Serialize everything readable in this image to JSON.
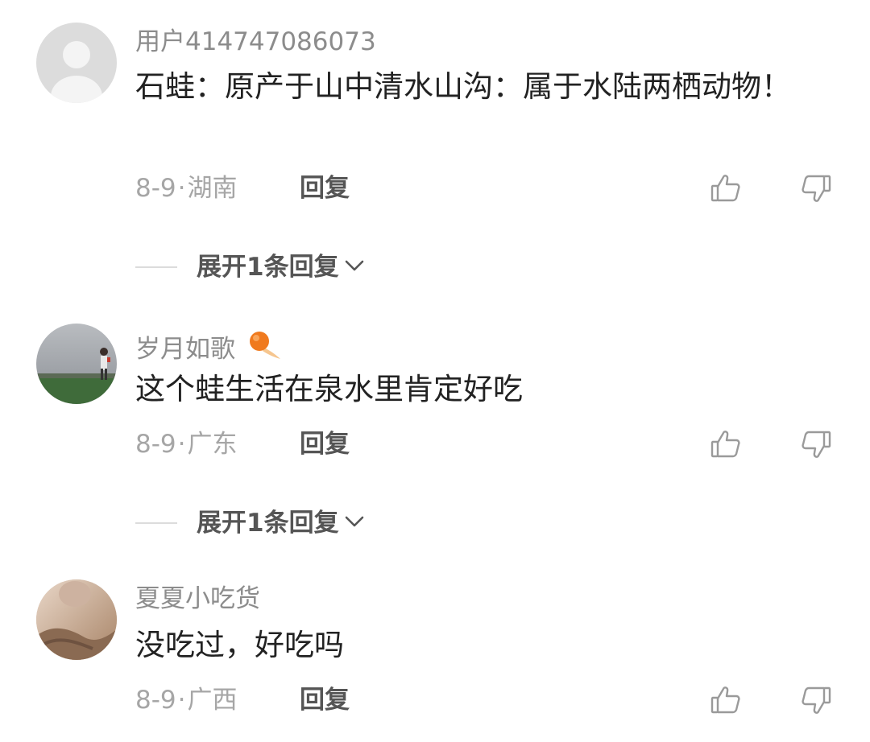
{
  "comments": [
    {
      "username": "用户414747086073",
      "content": "石蛙：原产于山中清水山沟：属于水陆两栖动物！",
      "date": "8-9",
      "separator": "·",
      "location": "湖南",
      "reply_label": "回复",
      "expand_label": "展开1条回复"
    },
    {
      "username": "岁月如歌",
      "content": "这个蛙生活在泉水里肯定好吃",
      "date": "8-9",
      "separator": "·",
      "location": "广东",
      "reply_label": "回复",
      "expand_label": "展开1条回复"
    },
    {
      "username": "夏夏小吃货",
      "content": "没吃过，好吃吗",
      "date": "8-9",
      "separator": "·",
      "location": "广西",
      "reply_label": "回复"
    }
  ],
  "icons": {
    "like": "thumbs-up-icon",
    "dislike": "thumbs-down-icon",
    "expand": "chevron-down-icon",
    "badge": "fire-ball-icon"
  },
  "colors": {
    "username": "#8c8c8c",
    "content": "#222222",
    "meta": "#a6a6a6",
    "action": "#555555",
    "badge": "#f07a1e"
  }
}
